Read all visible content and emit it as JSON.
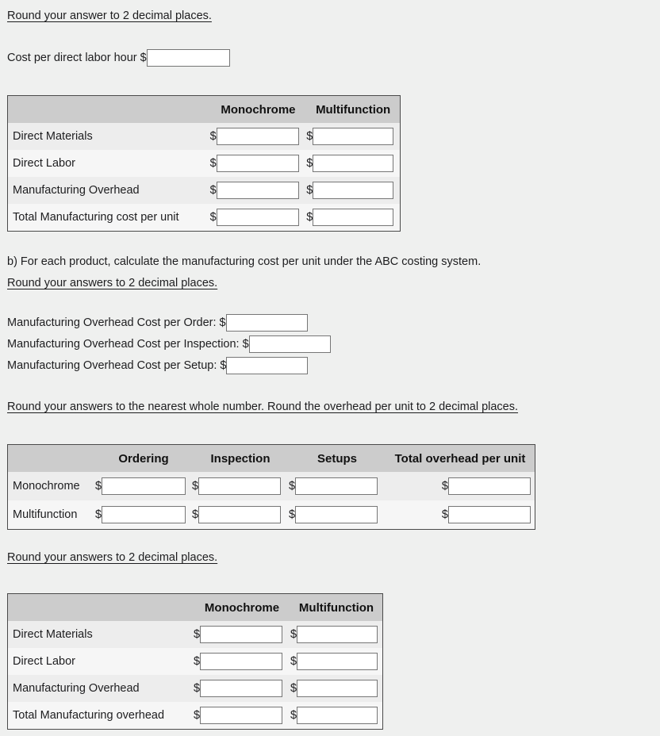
{
  "instructions": {
    "round_2dp_top": "Round your answer to 2 decimal places.",
    "round_2dp_b": "Round your answers to 2 decimal places.",
    "round_whole": "Round your answers to the nearest whole number. Round the overhead per unit to 2 decimal places.",
    "round_2dp_final": "Round your answers to 2 decimal places.",
    "part_b": "b) For each product, calculate the manufacturing cost per unit under the ABC costing system."
  },
  "cost_per_labor_hour": {
    "label": "Cost per direct labor hour",
    "currency": "$",
    "value": "",
    "placeholder": ""
  },
  "table_traditional": {
    "columns": [
      "",
      "Monochrome",
      "Multifunction"
    ],
    "currency": "$",
    "rows": [
      {
        "label": "Direct Materials",
        "monochrome": "",
        "multifunction": ""
      },
      {
        "label": "Direct Labor",
        "monochrome": "",
        "multifunction": ""
      },
      {
        "label": "Manufacturing Overhead",
        "monochrome": "",
        "multifunction": ""
      },
      {
        "label": "Total Manufacturing cost per unit",
        "monochrome": "",
        "multifunction": ""
      }
    ]
  },
  "overhead_rates": {
    "currency": "$",
    "items": [
      {
        "label": "Manufacturing Overhead Cost per Order:",
        "value": ""
      },
      {
        "label": "Manufacturing Overhead Cost per Inspection:",
        "value": ""
      },
      {
        "label": "Manufacturing Overhead Cost per Setup:",
        "value": ""
      }
    ]
  },
  "table_activity": {
    "columns": [
      "",
      "Ordering",
      "Inspection",
      "Setups",
      "Total overhead per unit"
    ],
    "currency": "$",
    "rows": [
      {
        "label": "Monochrome",
        "ordering": "",
        "inspection": "",
        "setups": "",
        "total_per_unit": ""
      },
      {
        "label": "Multifunction",
        "ordering": "",
        "inspection": "",
        "setups": "",
        "total_per_unit": ""
      }
    ]
  },
  "table_abc": {
    "columns": [
      "",
      "Monochrome",
      "Multifunction"
    ],
    "currency": "$",
    "rows": [
      {
        "label": "Direct Materials",
        "monochrome": "",
        "multifunction": ""
      },
      {
        "label": "Direct Labor",
        "monochrome": "",
        "multifunction": ""
      },
      {
        "label": "Manufacturing Overhead",
        "monochrome": "",
        "multifunction": ""
      },
      {
        "label": "Total Manufacturing overhead",
        "monochrome": "",
        "multifunction": ""
      }
    ]
  },
  "colors": {
    "page_background": "#eff0ef",
    "table_header": "#cccccc",
    "row_shade_a": "#ededed",
    "row_shade_b": "#f6f6f6",
    "table_border": "#4a4a4a",
    "input_border": "#767676",
    "text": "#1d1d1f"
  }
}
